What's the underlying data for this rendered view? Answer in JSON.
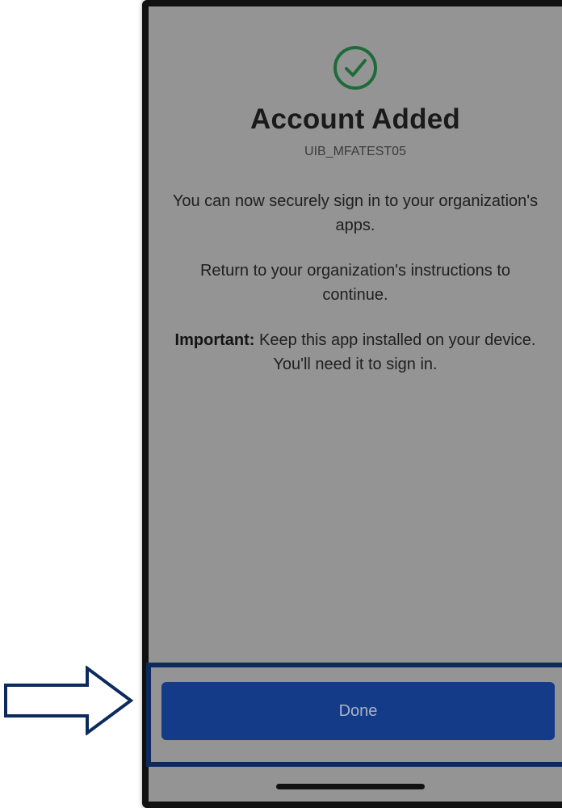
{
  "screen": {
    "title": "Account Added",
    "account_id": "UIB_MFATEST05",
    "message_1": "You can now securely sign in to your organization's apps.",
    "message_2": "Return to your organization's instructions to continue.",
    "message_3_bold": "Important:",
    "message_3_rest": " Keep this app installed on your device. You'll need it to sign in.",
    "done_label": "Done",
    "icon": "check-circle-icon"
  },
  "colors": {
    "screen_bg": "#949494",
    "check_icon": "#1e6b3a",
    "button_bg": "#133b87",
    "annotation": "#0c2b5c"
  }
}
